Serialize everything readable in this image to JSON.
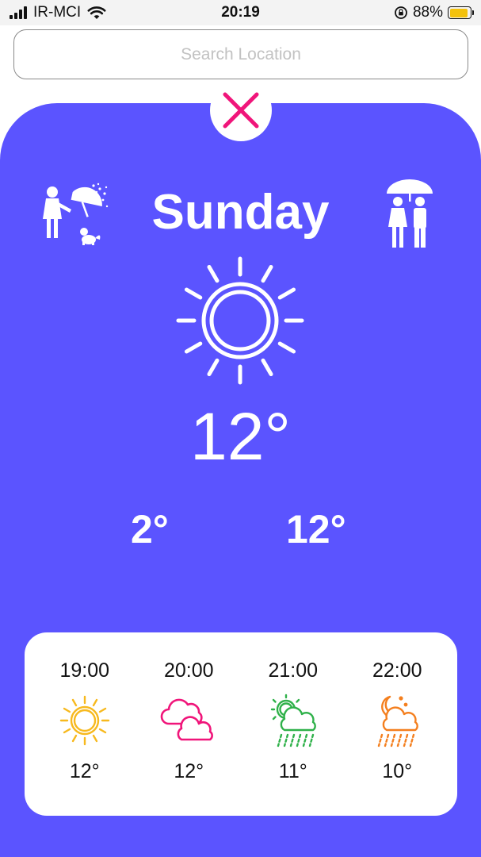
{
  "status_bar": {
    "carrier": "IR-MCI",
    "time": "20:19",
    "battery_percent": "88%",
    "battery_level": 0.88,
    "battery_color": "#f4c20d",
    "icons": [
      "signal-icon",
      "wifi-icon",
      "orientation-lock-icon",
      "battery-icon"
    ]
  },
  "search": {
    "placeholder": "Search Location",
    "value": ""
  },
  "colors": {
    "card_background": "#5b54ff",
    "close_accent": "#f0157a",
    "sun_hourly": "#f7b91e",
    "cloud_hourly": "#f0157a",
    "rain_hourly": "#2fb14a",
    "night_hourly": "#f47f1e"
  },
  "current": {
    "close_icon": "close-icon",
    "day": "Sunday",
    "left_icon": "girl-with-umbrella-and-dog-icon",
    "right_icon": "couple-under-umbrella-icon",
    "condition_icon": "sun-icon",
    "temperature": "12°",
    "min_temperature": "2°",
    "max_temperature": "12°"
  },
  "hourly": [
    {
      "time": "19:00",
      "icon": "sun-icon",
      "temp": "12°"
    },
    {
      "time": "20:00",
      "icon": "cloudy-icon",
      "temp": "12°"
    },
    {
      "time": "21:00",
      "icon": "sun-cloud-rain-icon",
      "temp": "11°"
    },
    {
      "time": "22:00",
      "icon": "moon-cloud-rain-icon",
      "temp": "10°"
    }
  ]
}
